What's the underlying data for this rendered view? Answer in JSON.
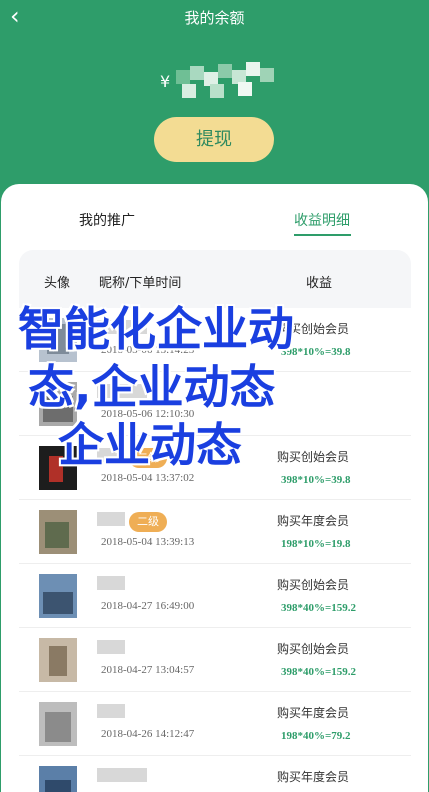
{
  "header": {
    "title": "我的余额",
    "back_icon": "chevron-left-icon"
  },
  "balance": {
    "currency": "¥",
    "amount_obscured": true
  },
  "withdraw_label": "提现",
  "tabs": [
    {
      "label": "我的推广",
      "active": false
    },
    {
      "label": "收益明细",
      "active": true
    }
  ],
  "table": {
    "columns": [
      "头像",
      "昵称/下单时间",
      "收益"
    ],
    "rows": [
      {
        "badge": "",
        "time": "2018-05-06 13:14:25",
        "desc": "购买创始会员",
        "calc": "398*10%=39.8"
      },
      {
        "badge": "",
        "time": "2018-05-06 12:10:30",
        "desc": "",
        "calc": ""
      },
      {
        "badge": "二级",
        "time": "2018-05-04 13:37:02",
        "desc": "购买创始会员",
        "calc": "398*10%=39.8"
      },
      {
        "badge": "二级",
        "time": "2018-05-04 13:39:13",
        "desc": "购买年度会员",
        "calc": "198*10%=19.8"
      },
      {
        "badge": "",
        "time": "2018-04-27 16:49:00",
        "desc": "购买创始会员",
        "calc": "398*40%=159.2"
      },
      {
        "badge": "",
        "time": "2018-04-27 13:04:57",
        "desc": "购买创始会员",
        "calc": "398*40%=159.2"
      },
      {
        "badge": "",
        "time": "2018-04-26 14:12:47",
        "desc": "购买年度会员",
        "calc": "198*40%=79.2"
      },
      {
        "badge": "",
        "time": "",
        "desc": "购买年度会员",
        "calc": ""
      }
    ]
  },
  "overlay": {
    "line1": "智能化企业动",
    "line2": "态,企业动态",
    "line3": "企业动态"
  },
  "colors": {
    "brand_green": "#2e9d6a",
    "button_gold": "#f3dc93",
    "badge_orange": "#efae55",
    "overlay_blue": "#1a3fe0"
  }
}
